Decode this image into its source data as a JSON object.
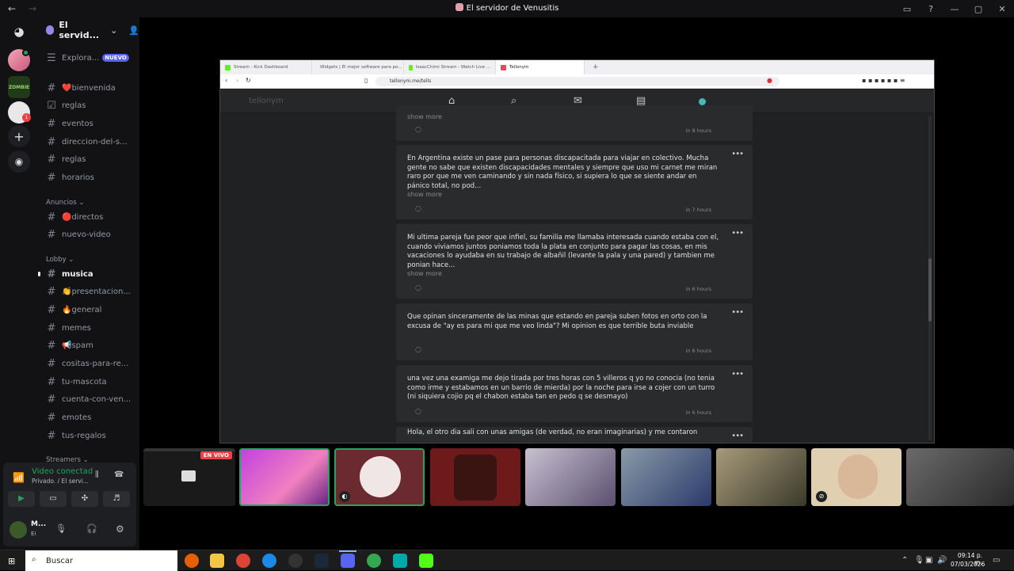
{
  "window": {
    "title": "El servidor de Venusitis"
  },
  "server": {
    "name": "El servid...",
    "explore_label": "Explora...",
    "explore_badge": "NUEVO"
  },
  "channels": [
    {
      "name": "❤️bienvenida",
      "icon": "#"
    },
    {
      "name": "reglas",
      "icon": "☑"
    },
    {
      "name": "eventos",
      "icon": "#"
    },
    {
      "name": "direccion-del-s...",
      "icon": "#"
    },
    {
      "name": "reglas",
      "icon": "#"
    },
    {
      "name": "horarios",
      "icon": "#"
    }
  ],
  "category_anuncios": "Anuncios",
  "channels_anuncios": [
    {
      "name": "🔴directos",
      "icon": "#"
    },
    {
      "name": "nuevo-video",
      "icon": "#"
    }
  ],
  "category_lobby": "Lobby",
  "channels_lobby": [
    {
      "name": "musica",
      "icon": "#"
    },
    {
      "name": "👏presentacion...",
      "icon": "#"
    },
    {
      "name": "🔥general",
      "icon": "#"
    },
    {
      "name": "memes",
      "icon": "#"
    },
    {
      "name": "📢spam",
      "icon": "#"
    },
    {
      "name": "cositas-para-re...",
      "icon": "#"
    },
    {
      "name": "tu-mascota",
      "icon": "#"
    },
    {
      "name": "cuenta-con-ven...",
      "icon": "#"
    },
    {
      "name": "emotes",
      "icon": "#"
    },
    {
      "name": "tus-regalos",
      "icon": "#"
    }
  ],
  "category_streamers": "Streamers",
  "voice": {
    "status": "Video conectad",
    "detail": "Privado. / El servi..."
  },
  "user": {
    "name": "M...",
    "status": "Ei"
  },
  "browser": {
    "tabs": [
      {
        "label": "Stream - Kick Dashboard",
        "color": "#53fc18"
      },
      {
        "label": "Widgets | El mejor software para po...",
        "color": "#888888"
      },
      {
        "label": "IsaacChimi Stream - Watch Live ...",
        "color": "#53fc18"
      },
      {
        "label": "Tellonym",
        "color": "#e8485a"
      }
    ],
    "url": "tellonym.me/tells",
    "app_title": "tellonym"
  },
  "feed": {
    "top_more": "show more",
    "top_time": "in 8 hours",
    "cards": [
      {
        "text": "En Argentina existe un pase para personas discapacitada para viajar en colectivo. Mucha gente no sabe que existen discapacidades mentales y siempre que uso mi carnet me miran raro por que me ven caminando y sin nada físico, si supiera lo que se siente andar en pánico total, no pod...",
        "more": "show more",
        "time": "in 7 hours"
      },
      {
        "text": "Mi ultima pareja fue peor que infiel, su familia me llamaba interesada cuando estaba con el, cuando viviamos juntos poniamos toda la plata en conjunto para pagar las cosas, en mis vacaciones lo ayudaba en su trabajo de albañil (levante la pala y una pared) y tambien me ponian hace...",
        "more": "show more",
        "time": "in 6 hours"
      },
      {
        "text": "Que opinan sinceramente de las minas que estando en pareja suben fotos en orto con la excusa de \"ay es para mi que me veo linda\"? Mi opinion es que terrible buta inviable",
        "more": "",
        "time": "in 6 hours"
      },
      {
        "text": "una vez una examiga me dejo tirada por tres horas con 5 villeros q yo no conocia (no tenia como irme y estabamos en un barrio de mierda) por la noche para irse a cojer con un turro (ni siquiera cojio pq el chabon estaba tan en pedo q se desmayo)",
        "more": "",
        "time": "in 6 hours"
      },
      {
        "text": "Hola, el otro dia sali con unas amigas (de verdad, no eran imaginarias) y me contaron",
        "more": "",
        "time": ""
      }
    ]
  },
  "stream": {
    "live_badge": "EN VIVO"
  },
  "taskbar": {
    "search_placeholder": "Buscar",
    "time": "09:14 p. m.",
    "date": "07/03/2026"
  }
}
